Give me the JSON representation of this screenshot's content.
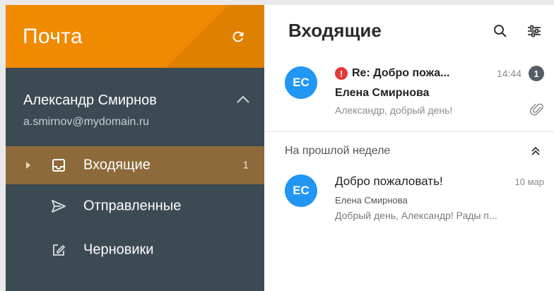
{
  "sidebar": {
    "app_title": "Почта",
    "refresh_icon": "refresh-icon",
    "account": {
      "name": "Александр Смирнов",
      "email": "a.smirnov@mydomain.ru"
    },
    "folders": [
      {
        "label": "Входящие",
        "count": "1",
        "icon": "inbox-icon",
        "active": true
      },
      {
        "label": "Отправленные",
        "count": "",
        "icon": "send-icon",
        "active": false
      },
      {
        "label": "Черновики",
        "count": "",
        "icon": "draft-icon",
        "active": false
      }
    ]
  },
  "main": {
    "title": "Входящие",
    "messages_today": [
      {
        "avatar": "EC",
        "subject": "Re: Добро пожа...",
        "time": "14:44",
        "unread_count": "1",
        "sender": "Елена Смирнова",
        "preview": "Александр, добрый день!",
        "important": true,
        "has_attachment": true
      }
    ],
    "group_last_week": {
      "title": "На прошлой неделе",
      "messages": [
        {
          "avatar": "EC",
          "subject": "Добро пожаловать!",
          "time": "10 мар",
          "sender": "Елена Смирнова",
          "preview": "Добрый день, Александр! Рады п..."
        }
      ]
    }
  },
  "colors": {
    "header_orange": "#f08a00",
    "sidebar_bg": "#3c4a53",
    "active_folder_bg": "#8c6a3a",
    "avatar_blue": "#2196f3",
    "important_red": "#e53935",
    "badge_gray": "#555e66"
  }
}
